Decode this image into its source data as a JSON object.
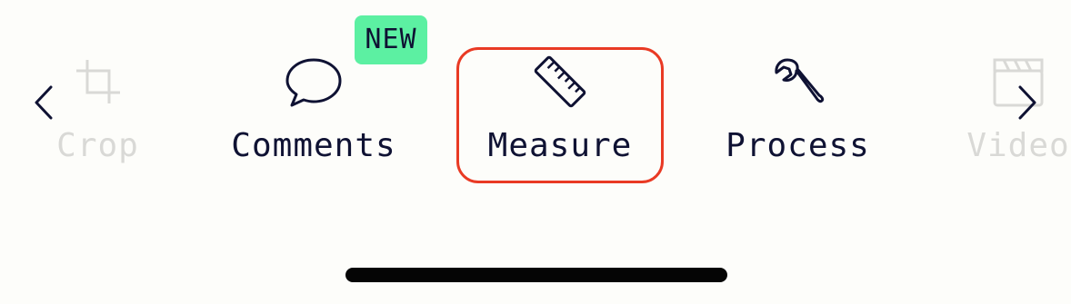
{
  "badge": {
    "text": "NEW",
    "color": "#5cf0a2"
  },
  "accent": {
    "selected_border": "#e93a24"
  },
  "navigation": {
    "left_icon": "chevron-left-icon",
    "right_icon": "chevron-right-icon"
  },
  "tools": [
    {
      "label": "Crop",
      "icon": "crop-icon",
      "state": "faded"
    },
    {
      "label": "Comments",
      "icon": "speech-bubble-icon",
      "state": "normal",
      "badge": "NEW"
    },
    {
      "label": "Measure",
      "icon": "ruler-icon",
      "state": "selected"
    },
    {
      "label": "Process",
      "icon": "wrench-icon",
      "state": "normal"
    },
    {
      "label": "Video",
      "icon": "clapperboard-icon",
      "state": "faded"
    }
  ]
}
